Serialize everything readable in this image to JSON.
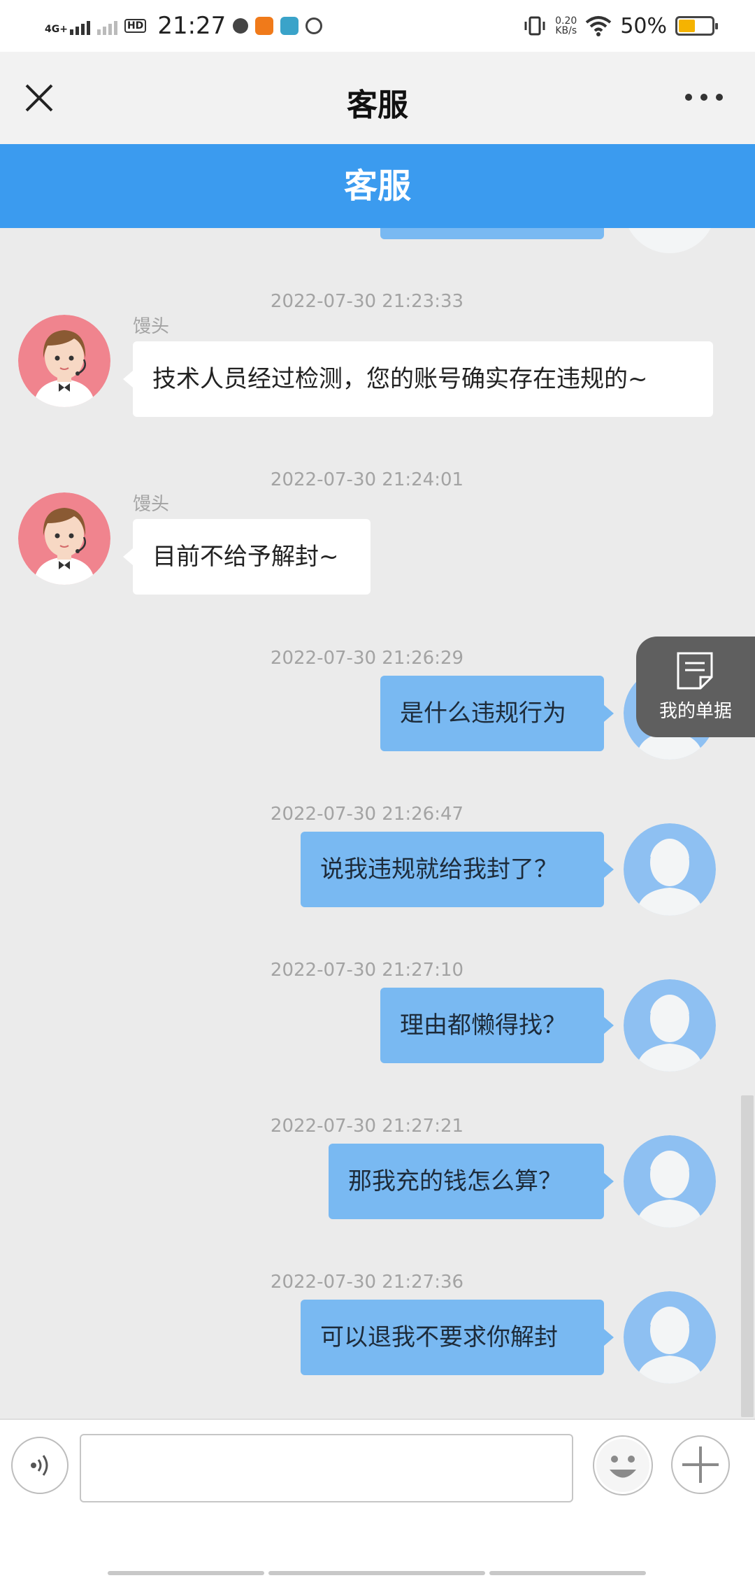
{
  "status_bar": {
    "network": "4G+",
    "hd": "HD",
    "time": "21:27",
    "speed_value": "0.20",
    "speed_unit": "KB/s",
    "battery": "50%",
    "battery_level": 0.5,
    "icons": [
      "signal-icon",
      "hd-icon",
      "music-app-icon",
      "game-app-icon-1",
      "game-app-icon-2",
      "netease-music-icon",
      "vibrate-icon",
      "wifi-icon",
      "battery-icon"
    ]
  },
  "nav": {
    "title": "客服",
    "close_icon": "close-icon",
    "more_icon": "more-icon"
  },
  "banner": {
    "title": "客服"
  },
  "floating": {
    "receipt_label": "我的单据",
    "icon": "document-icon"
  },
  "colors": {
    "banner": "#3b9bef",
    "outgoing_bubble": "#79b9f2",
    "incoming_bubble": "#ffffff",
    "chat_background": "#ebebeb",
    "agent_avatar_bg": "#f0848e",
    "user_avatar_bg": "#8ec0f2"
  },
  "messages": [
    {
      "time": "2022-07-30 21:23:33",
      "direction": "in",
      "sender": "馒头",
      "text": "技术人员经过检测，您的账号确实存在违规的~"
    },
    {
      "time": "2022-07-30 21:24:01",
      "direction": "in",
      "sender": "馒头",
      "text": "目前不给予解封~"
    },
    {
      "time": "2022-07-30 21:26:29",
      "direction": "out",
      "text": "是什么违规行为"
    },
    {
      "time": "2022-07-30 21:26:47",
      "direction": "out",
      "text": "说我违规就给我封了？"
    },
    {
      "time": "2022-07-30 21:27:10",
      "direction": "out",
      "text": "理由都懒得找？"
    },
    {
      "time": "2022-07-30 21:27:21",
      "direction": "out",
      "text": "那我充的钱怎么算？"
    },
    {
      "time": "2022-07-30 21:27:36",
      "direction": "out",
      "text": "可以退我不要求你解封"
    }
  ],
  "input": {
    "value": "",
    "placeholder": "",
    "voice_icon": "voice-icon",
    "emoji_icon": "emoji-icon",
    "plus_icon": "plus-icon"
  }
}
